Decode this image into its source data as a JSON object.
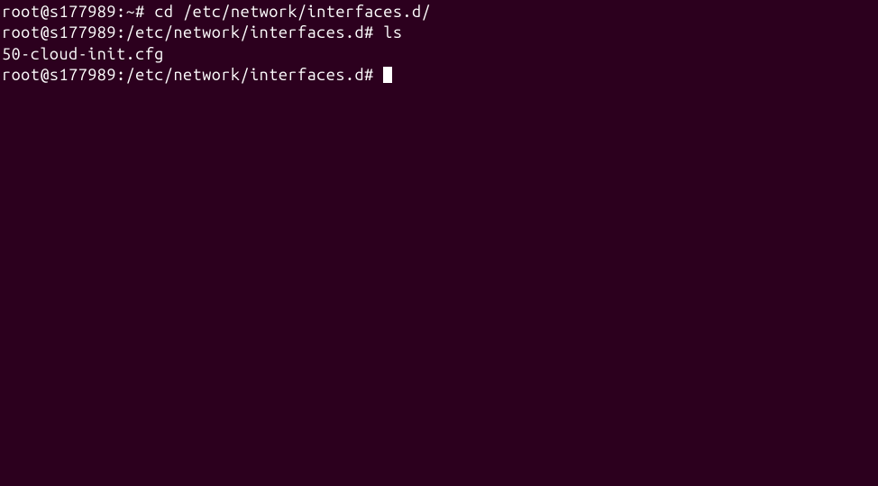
{
  "terminal": {
    "lines": [
      {
        "prompt_user_host": "root@s177989",
        "prompt_path": "~",
        "prompt_symbol": "#",
        "command": "cd /etc/network/interfaces.d/"
      },
      {
        "prompt_user_host": "root@s177989",
        "prompt_path": "/etc/network/interfaces.d",
        "prompt_symbol": "#",
        "command": "ls"
      },
      {
        "output": "50-cloud-init.cfg"
      },
      {
        "prompt_user_host": "root@s177989",
        "prompt_path": "/etc/network/interfaces.d",
        "prompt_symbol": "#",
        "command": "",
        "cursor": true
      }
    ]
  }
}
